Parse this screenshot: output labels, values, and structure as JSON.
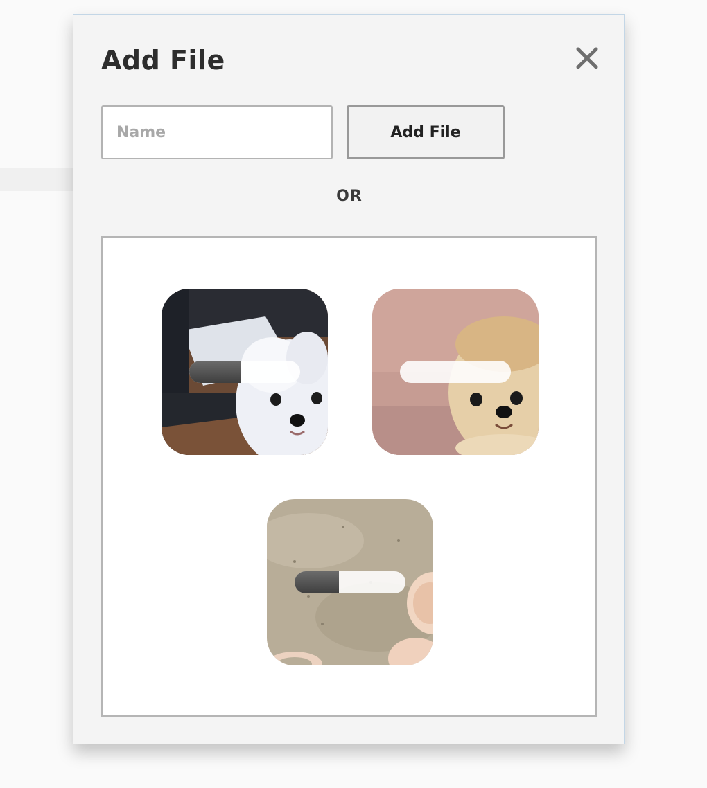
{
  "modal": {
    "title": "Add File",
    "close_icon": "close-icon"
  },
  "form": {
    "name_placeholder": "Name",
    "name_value": "",
    "add_button_label": "Add File"
  },
  "separator": {
    "label": "OR"
  },
  "uploads": [
    {
      "subject": "white fluffy dog on wooden floor",
      "progress": 0.46
    },
    {
      "subject": "cream puppy on pink background",
      "progress": 0.0
    },
    {
      "subject": "sand with seashells",
      "progress": 0.4
    }
  ],
  "colors": {
    "modal_bg": "#f4f4f4",
    "modal_border": "#c3d6e6",
    "progress_fill": "#4a4a4a",
    "progress_track": "#f5f5f5"
  }
}
